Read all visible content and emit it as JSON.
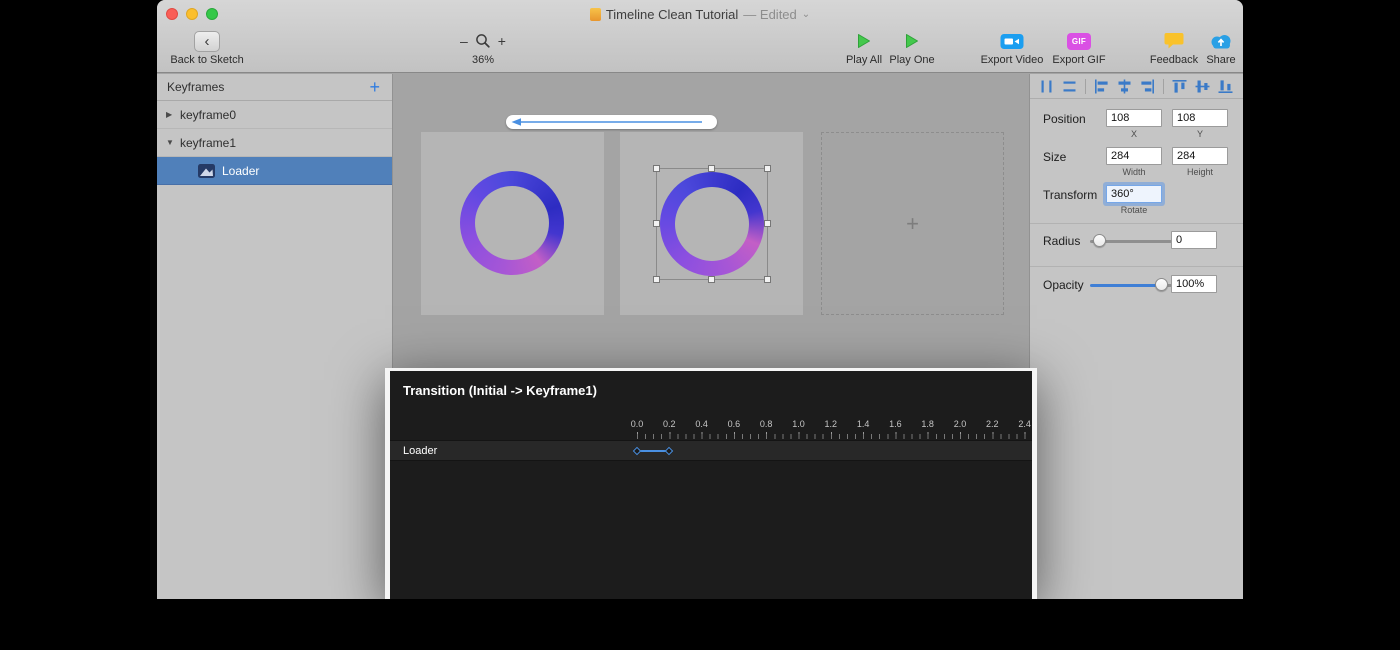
{
  "window": {
    "title": "Timeline Clean Tutorial",
    "edited_suffix": "— Edited",
    "title_chevron": "⌄"
  },
  "toolbar": {
    "back": {
      "label": "Back to Sketch",
      "chevron": "‹"
    },
    "zoom": {
      "minus": "–",
      "plus": "+",
      "level": "36%"
    },
    "play_all": "Play All",
    "play_one": "Play One",
    "export_video": "Export Video",
    "export_gif": {
      "label": "Export GIF",
      "badge": "GIF"
    },
    "feedback": "Feedback",
    "share": "Share"
  },
  "sidebar": {
    "header": "Keyframes",
    "add_button": "+",
    "rows": [
      {
        "label": "keyframe0",
        "disclosure": "▶",
        "selected": false
      },
      {
        "label": "keyframe1",
        "disclosure": "▼",
        "selected": false
      },
      {
        "label": "Loader",
        "selected": true
      }
    ]
  },
  "canvas": {
    "empty_artboard_plus": "+"
  },
  "inspector": {
    "position": {
      "label": "Position",
      "x": "108",
      "y": "108",
      "x_sub": "X",
      "y_sub": "Y"
    },
    "size": {
      "label": "Size",
      "width": "284",
      "height": "284",
      "width_sub": "Width",
      "height_sub": "Height"
    },
    "transform": {
      "label": "Transform",
      "rotate": "360°",
      "rotate_sub": "Rotate"
    },
    "radius": {
      "label": "Radius",
      "value": "0"
    },
    "opacity": {
      "label": "Opacity",
      "value": "100%"
    }
  },
  "timeline": {
    "title": "Transition (Initial -> Keyframe1)",
    "ruler": [
      "0.0",
      "0.2",
      "0.4",
      "0.6",
      "0.8",
      "1.0",
      "1.2",
      "1.4",
      "1.6",
      "1.8",
      "2.0",
      "2.2",
      "2.4"
    ],
    "rows": [
      {
        "label": "Loader",
        "keyframes_sec": [
          0.0,
          0.2
        ]
      }
    ]
  },
  "colors": {
    "accent_blue": "#4a90e2",
    "selected_row_blue": "#5080ba",
    "play_green": "#44c84c",
    "export_video_blue": "#1b9ef0",
    "export_gif_magenta": "#da50e4",
    "feedback_yellow": "#f9c22b",
    "share_blue": "#2aa0e5",
    "loader_ring_colors": [
      "#2d2cc2",
      "#4d49dc",
      "#8b4fe0",
      "#c35fc6"
    ]
  }
}
